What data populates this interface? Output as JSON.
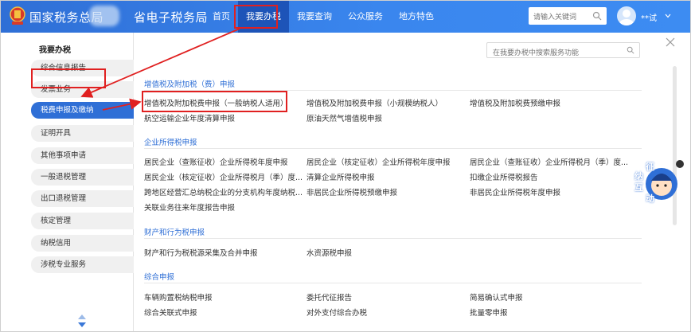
{
  "header": {
    "title_part1": "国家税务总局",
    "title_part2": "省电子税务局",
    "nav": [
      "首页",
      "我要办税",
      "我要查询",
      "公众服务",
      "地方特色"
    ],
    "active_nav_index": 1,
    "search_placeholder": "请输入关键词",
    "user_name": "**试",
    "brand_color": "#3a86ee",
    "highlight_color": "#e02020"
  },
  "sidebar": {
    "title": "我要办税",
    "items": [
      "综合信息报告",
      "发票业务",
      "税费申报及缴纳",
      "证明开具",
      "其他事项申请",
      "一般退税管理",
      "出口退税管理",
      "核定管理",
      "纳税信用",
      "涉税专业服务"
    ],
    "active_index": 2
  },
  "main": {
    "search_placeholder": "在我要办税中搜索服务功能",
    "sections": [
      {
        "title": "增值税及附加税（费）申报",
        "links": [
          [
            "增值税及附加税费申报（一般纳税人适用）",
            "增值税及附加税费申报（小规模纳税人）",
            "增值税及附加税费预缴申报"
          ],
          [
            "航空运输企业年度清算申报",
            "原油天然气增值税申报",
            ""
          ]
        ]
      },
      {
        "title": "企业所得税申报",
        "links": [
          [
            "居民企业（查账征收）企业所得税年度申报",
            "居民企业（核定征收）企业所得税年度申报",
            "居民企业（查账征收）企业所得税月（季）度..."
          ],
          [
            "居民企业（核定征收）企业所得税月（季）度...",
            "清算企业所得税申报",
            "扣缴企业所得税报告"
          ],
          [
            "跨地区经营汇总纳税企业的分支机构年度纳税...",
            "非居民企业所得税预缴申报",
            "非居民企业所得税年度申报"
          ],
          [
            "关联业务往来年度报告申报",
            "",
            ""
          ]
        ]
      },
      {
        "title": "财产和行为税申报",
        "links": [
          [
            "财产和行为税税源采集及合并申报",
            "水资源税申报",
            ""
          ]
        ]
      },
      {
        "title": "综合申报",
        "links": [
          [
            "车辆购置税纳税申报",
            "委托代征报告",
            "简易确认式申报"
          ],
          [
            "综合关联式申报",
            "对外支付综合办税",
            "批量零申报"
          ]
        ]
      }
    ]
  },
  "mascot": {
    "text": [
      "征",
      "纳",
      "互",
      "动"
    ]
  }
}
